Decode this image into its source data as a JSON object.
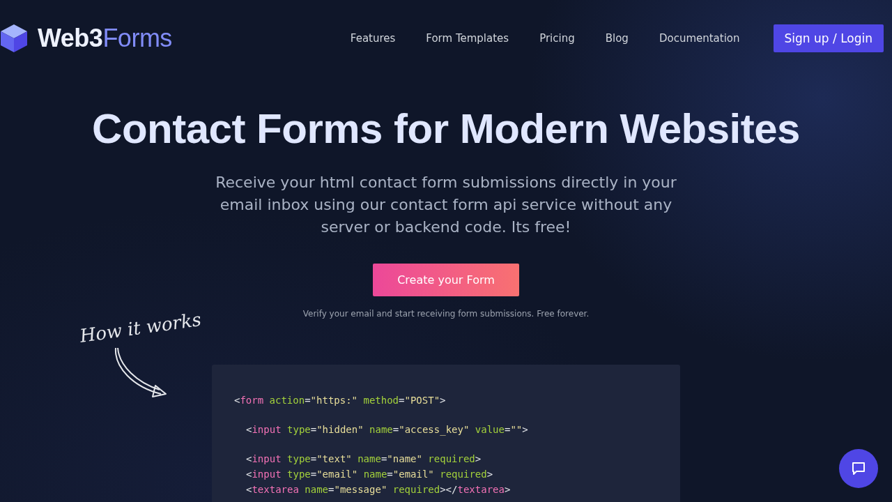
{
  "header": {
    "logo": {
      "first": "Web3",
      "second": "Forms"
    },
    "nav": [
      {
        "label": "Features"
      },
      {
        "label": "Form Templates"
      },
      {
        "label": "Pricing"
      },
      {
        "label": "Blog"
      },
      {
        "label": "Documentation"
      }
    ],
    "cta": "Sign up / Login"
  },
  "hero": {
    "title": "Contact Forms for Modern Websites",
    "subtitle": "Receive your html contact form submissions directly in your email inbox using our contact form api service without any server or backend code. Its free!",
    "button": "Create your Form",
    "note": "Verify your email and start receiving form submissions. Free forever."
  },
  "how_it_works": "How it works",
  "code": [
    {
      "tokens": [
        {
          "kind": "punct",
          "text": "<"
        },
        {
          "kind": "tag",
          "text": "form"
        },
        {
          "kind": "attr",
          "text": " action"
        },
        {
          "kind": "punct",
          "text": "="
        },
        {
          "kind": "string",
          "text": "\"https:\""
        },
        {
          "kind": "attr",
          "text": " method"
        },
        {
          "kind": "punct",
          "text": "="
        },
        {
          "kind": "string",
          "text": "\"POST\""
        },
        {
          "kind": "punct",
          "text": ">"
        }
      ],
      "children": [
        {
          "lines": [
            {
              "tokens": [
                {
                  "kind": "punct",
                  "text": "<"
                },
                {
                  "kind": "tag",
                  "text": "input"
                },
                {
                  "kind": "attr",
                  "text": " type"
                },
                {
                  "kind": "punct",
                  "text": "="
                },
                {
                  "kind": "string",
                  "text": "\"hidden\""
                },
                {
                  "kind": "attr",
                  "text": " name"
                },
                {
                  "kind": "punct",
                  "text": "="
                },
                {
                  "kind": "string",
                  "text": "\"access_key\""
                },
                {
                  "kind": "attr",
                  "text": " value"
                },
                {
                  "kind": "punct",
                  "text": "="
                },
                {
                  "kind": "string",
                  "text": "\"\""
                },
                {
                  "kind": "punct",
                  "text": ">"
                }
              ]
            }
          ]
        },
        {
          "lines": [
            {
              "tokens": [
                {
                  "kind": "punct",
                  "text": "<"
                },
                {
                  "kind": "tag",
                  "text": "input"
                },
                {
                  "kind": "attr",
                  "text": " type"
                },
                {
                  "kind": "punct",
                  "text": "="
                },
                {
                  "kind": "string",
                  "text": "\"text\""
                },
                {
                  "kind": "attr",
                  "text": " name"
                },
                {
                  "kind": "punct",
                  "text": "="
                },
                {
                  "kind": "string",
                  "text": "\"name\""
                },
                {
                  "kind": "attr",
                  "text": " required"
                },
                {
                  "kind": "punct",
                  "text": ">"
                }
              ]
            },
            {
              "tokens": [
                {
                  "kind": "punct",
                  "text": "<"
                },
                {
                  "kind": "tag",
                  "text": "input"
                },
                {
                  "kind": "attr",
                  "text": " type"
                },
                {
                  "kind": "punct",
                  "text": "="
                },
                {
                  "kind": "string",
                  "text": "\"email\""
                },
                {
                  "kind": "attr",
                  "text": " name"
                },
                {
                  "kind": "punct",
                  "text": "="
                },
                {
                  "kind": "string",
                  "text": "\"email\""
                },
                {
                  "kind": "attr",
                  "text": " required"
                },
                {
                  "kind": "punct",
                  "text": ">"
                }
              ]
            },
            {
              "tokens": [
                {
                  "kind": "punct",
                  "text": "<"
                },
                {
                  "kind": "tag",
                  "text": "textarea"
                },
                {
                  "kind": "attr",
                  "text": " name"
                },
                {
                  "kind": "punct",
                  "text": "="
                },
                {
                  "kind": "string",
                  "text": "\"message\""
                },
                {
                  "kind": "attr",
                  "text": " required"
                },
                {
                  "kind": "punct",
                  "text": "></"
                },
                {
                  "kind": "tag",
                  "text": "textarea"
                },
                {
                  "kind": "punct",
                  "text": ">"
                }
              ]
            }
          ]
        }
      ]
    }
  ]
}
